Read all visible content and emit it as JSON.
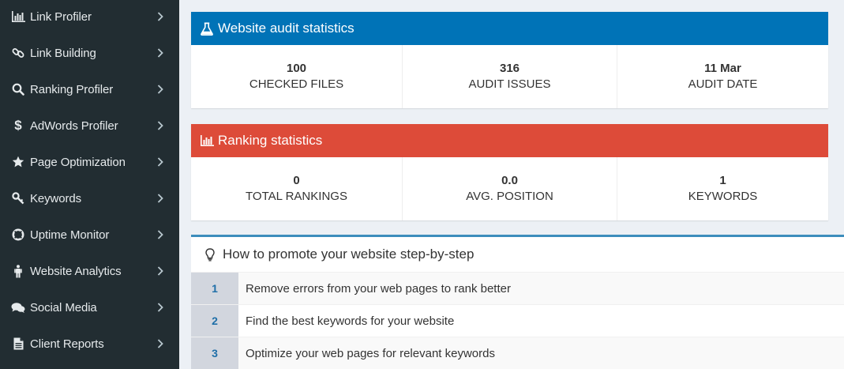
{
  "sidebar": {
    "items": [
      {
        "label": "Link Profiler",
        "icon": "bar-chart-icon"
      },
      {
        "label": "Link Building",
        "icon": "link-icon"
      },
      {
        "label": "Ranking Profiler",
        "icon": "search-icon"
      },
      {
        "label": "AdWords Profiler",
        "icon": "dollar-icon"
      },
      {
        "label": "Page Optimization",
        "icon": "star-icon"
      },
      {
        "label": "Keywords",
        "icon": "key-icon"
      },
      {
        "label": "Uptime Monitor",
        "icon": "life-ring-icon"
      },
      {
        "label": "Website Analytics",
        "icon": "person-icon"
      },
      {
        "label": "Social Media",
        "icon": "comments-icon"
      },
      {
        "label": "Client Reports",
        "icon": "file-icon"
      }
    ]
  },
  "audit": {
    "title": "Website audit statistics",
    "color": "#0073b7",
    "stats": [
      {
        "value": "100",
        "label": "CHECKED FILES"
      },
      {
        "value": "316",
        "label": "AUDIT ISSUES"
      },
      {
        "value": "11 Mar",
        "label": "AUDIT DATE"
      }
    ]
  },
  "ranking": {
    "title": "Ranking statistics",
    "color": "#dd4b39",
    "stats": [
      {
        "value": "0",
        "label": "TOTAL RANKINGS"
      },
      {
        "value": "0.0",
        "label": "AVG. POSITION"
      },
      {
        "value": "1",
        "label": "KEYWORDS"
      }
    ]
  },
  "steps": {
    "title": "How to promote your website step-by-step",
    "icon": "lightbulb-icon",
    "items": [
      {
        "num": "1",
        "text": "Remove errors from your web pages to rank better"
      },
      {
        "num": "2",
        "text": "Find the best keywords for your website"
      },
      {
        "num": "3",
        "text": "Optimize your web pages for relevant keywords"
      }
    ]
  }
}
